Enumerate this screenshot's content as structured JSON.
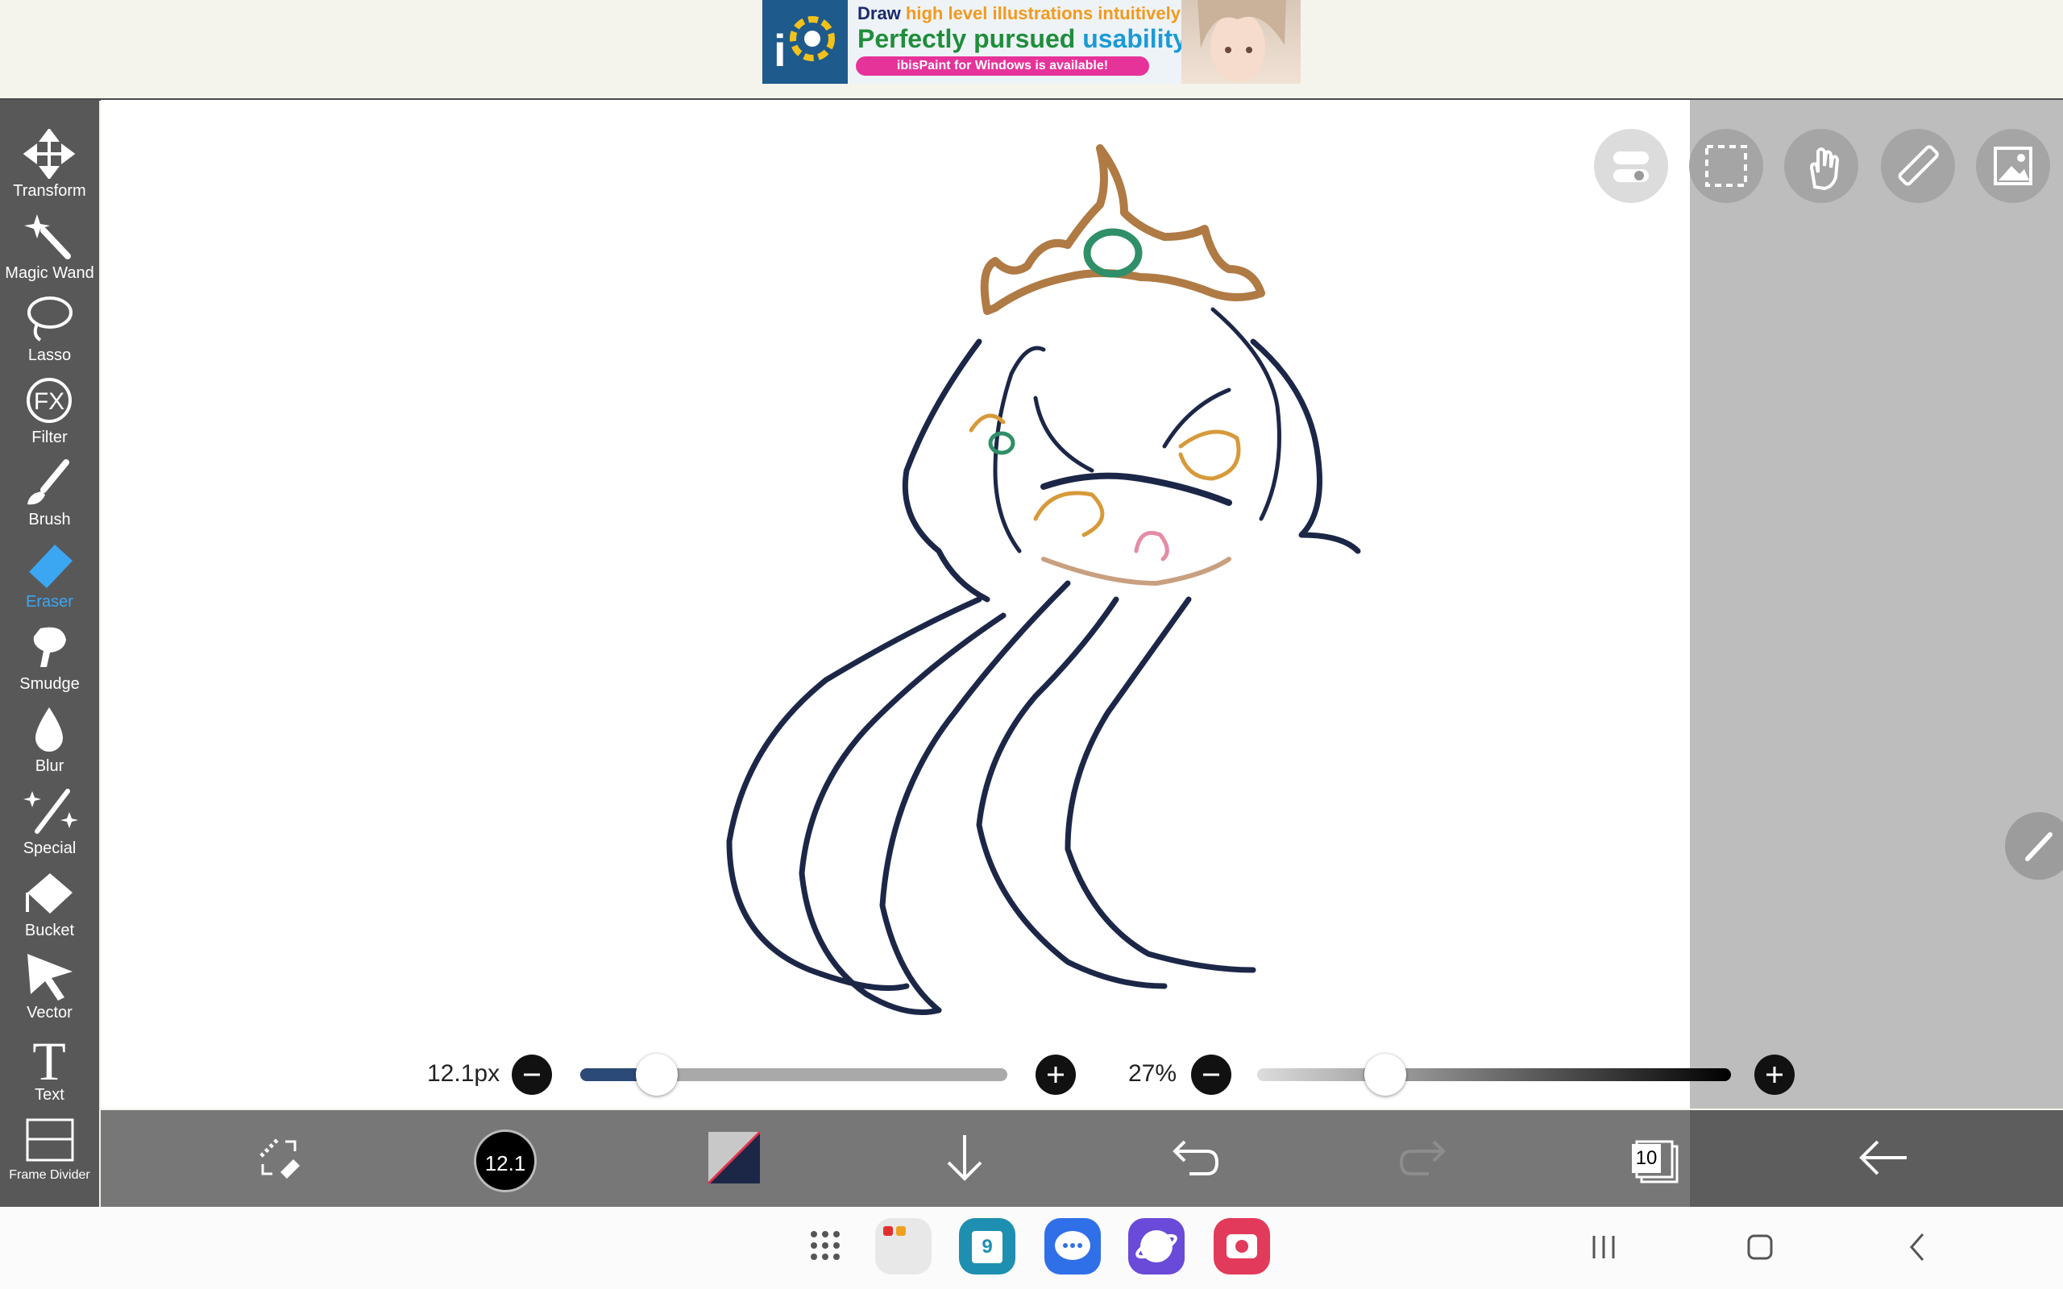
{
  "ad": {
    "line1_draw": "Draw ",
    "line1_rest": "high level illustrations intuitively!",
    "line2_a": "Perfectly pursued ",
    "line2_b": "usability!",
    "pill": "ibisPaint for Windows is available!",
    "colors": {
      "dark_blue": "#1b2a6b",
      "orange": "#f39a1c",
      "green": "#1f8e3a",
      "blue": "#1c9ad6",
      "pink": "#e6339a"
    }
  },
  "toolbar": {
    "tools": [
      {
        "label": "Transform",
        "icon": "move-arrows-icon"
      },
      {
        "label": "Magic Wand",
        "icon": "magic-wand-icon"
      },
      {
        "label": "Lasso",
        "icon": "lasso-icon"
      },
      {
        "label": "Filter",
        "icon": "fx-icon"
      },
      {
        "label": "Brush",
        "icon": "brush-icon"
      },
      {
        "label": "Eraser",
        "icon": "eraser-icon",
        "active": true
      },
      {
        "label": "Smudge",
        "icon": "smudge-icon"
      },
      {
        "label": "Blur",
        "icon": "blur-drop-icon"
      },
      {
        "label": "Special",
        "icon": "special-sparkle-icon"
      },
      {
        "label": "Bucket",
        "icon": "bucket-icon"
      },
      {
        "label": "Vector",
        "icon": "vector-cursor-icon"
      },
      {
        "label": "Text",
        "icon": "text-t-icon"
      },
      {
        "label": "Frame Divider",
        "icon": "frame-divider-icon"
      }
    ],
    "active_color": "#3ba6f2"
  },
  "canvas_controls": {
    "icons": [
      "toggle-icon",
      "selection-icon",
      "hand-icon",
      "ruler-icon",
      "reference-image-icon"
    ]
  },
  "size_slider": {
    "value_label": "12.1px",
    "level": 0.18
  },
  "opacity_slider": {
    "value_label": "27%",
    "level": 0.27
  },
  "bottom_toolbar": {
    "brush_size_label": "12.1",
    "layers_count": "10",
    "icons": [
      "swap-tool-icon",
      "brush-size-icon",
      "color-swatch-icon",
      "download-arrow-icon",
      "undo-icon",
      "redo-icon",
      "layers-icon",
      "back-arrow-icon"
    ]
  },
  "android_nav": {
    "calendar_day": "9"
  }
}
